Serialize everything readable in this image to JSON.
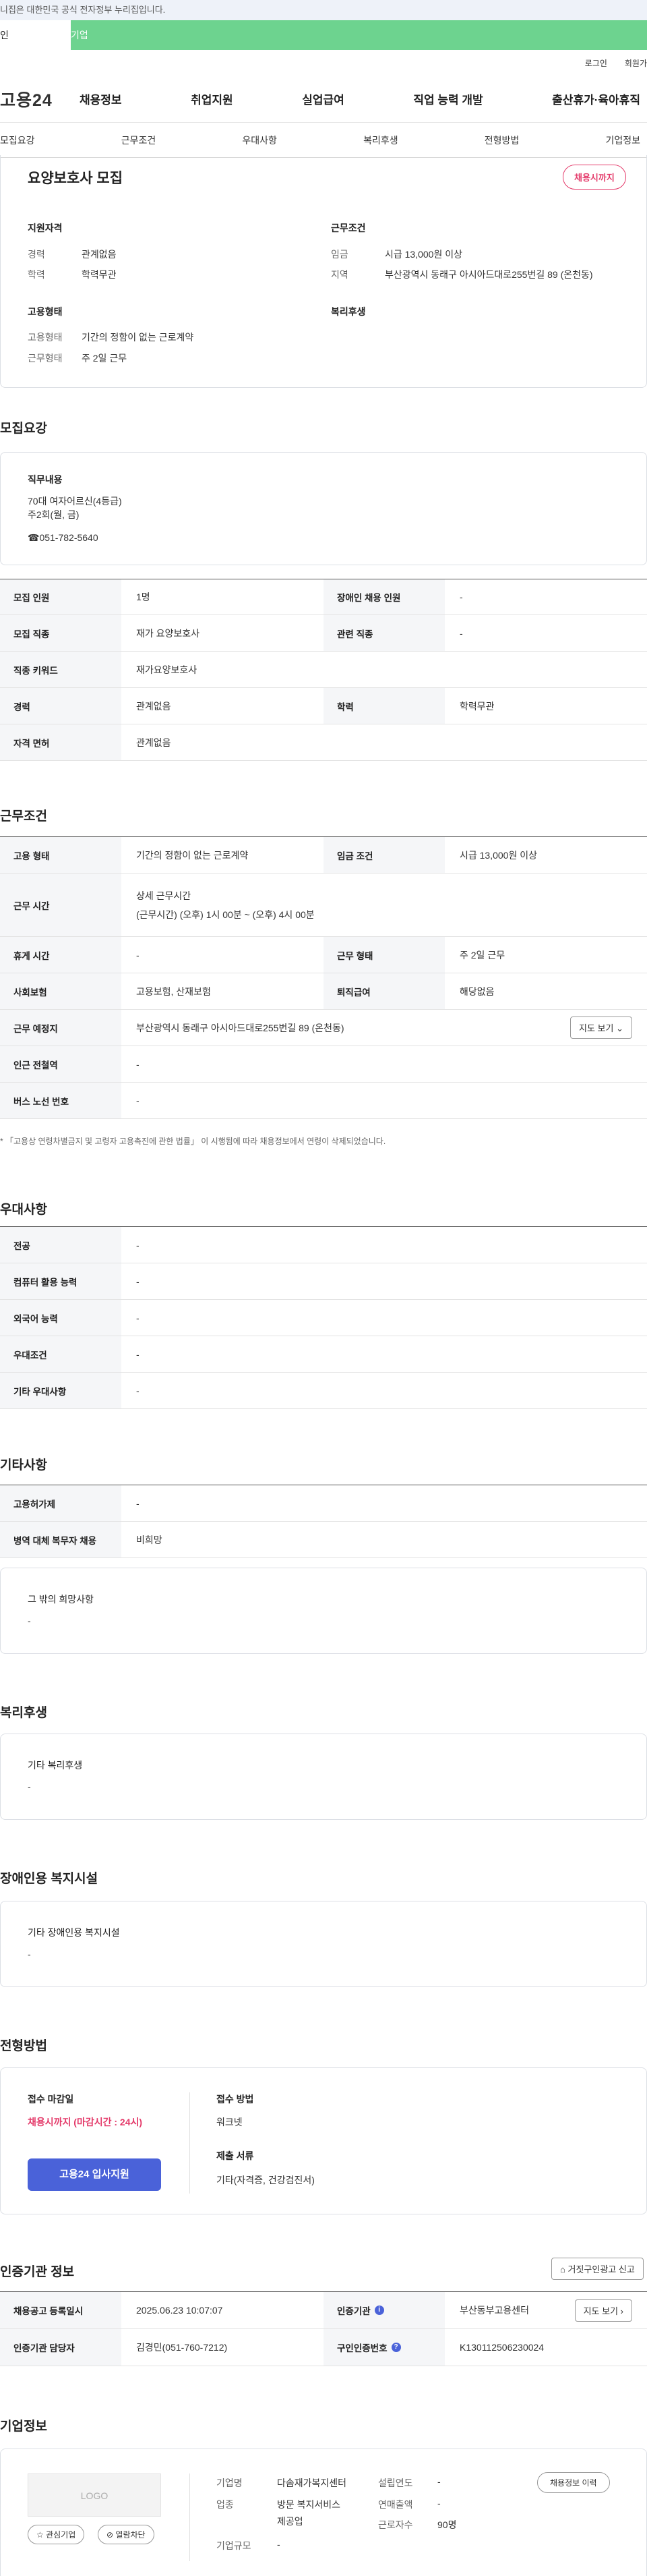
{
  "top": {
    "notice": "니집은 대한민국 공식 전자정부 누리집입니다.",
    "tab_a": "인",
    "tab_b": "기업",
    "login": "로그인",
    "signup": "회원가"
  },
  "gnb": {
    "logo": "고용24",
    "menu": [
      "채용정보",
      "취업지원",
      "실업급여",
      "직업 능력 개발",
      "출산휴가·육아휴직"
    ]
  },
  "subnav": [
    "모집요강",
    "근무조건",
    "우대사항",
    "복리후생",
    "전형방법",
    "기업정보"
  ],
  "summary": {
    "title": "요양보호사 모집",
    "status_badge": "채용시까지",
    "qual_title": "지원자격",
    "career_label": "경력",
    "career_value": "관계없음",
    "edu_label": "학력",
    "edu_value": "학력무관",
    "emp_title": "고용형태",
    "emp_type_label": "고용형태",
    "emp_type_value": "기간의 정함이 없는 근로계약",
    "work_type_label": "근무형태",
    "work_type_value": "주 2일 근무",
    "cond_title": "근무조건",
    "wage_label": "임금",
    "wage_value": "시급 13,000원 이상",
    "area_label": "지역",
    "area_value": "부산광역시 동래구 아시아드대로255번길 89 (온천동)",
    "welfare_title": "복리후생"
  },
  "recruit": {
    "section_title": "모집요강",
    "duty_title": "직무내용",
    "duty_line1": "70대 여자어르신(4등급)",
    "duty_line2": "주2회(월, 금)",
    "duty_line3": "☎051-782-5640",
    "rows": [
      [
        "모집 인원",
        "1명",
        "장애인 채용 인원",
        "-"
      ],
      [
        "모집 직종",
        "재가 요양보호사",
        "관련 직종",
        "-"
      ],
      [
        "직종 키워드",
        "재가요양보호사"
      ],
      [
        "경력",
        "관계없음",
        "학력",
        "학력무관"
      ],
      [
        "자격 면허",
        "관계없음"
      ]
    ]
  },
  "conditions": {
    "section_title": "근무조건",
    "emp_label": "고용 형태",
    "emp_value": "기간의 정함이 없는 근로계약",
    "wage_label": "임금 조건",
    "wage_value": "시급 13,000원 이상",
    "hours_label": "근무 시간",
    "hours_line1": "상세 근무시간",
    "hours_line2": "(근무시간) (오후) 1시 00분 ~ (오후) 4시 00분",
    "rest_label": "휴게 시간",
    "rest_value": "-",
    "form_label": "근무 형태",
    "form_value": "주 2일 근무",
    "ins_label": "사회보험",
    "ins_value": "고용보험, 산재보험",
    "sev_label": "퇴직급여",
    "sev_value": "해당없음",
    "place_label": "근무 예정지",
    "place_value": "부산광역시 동래구 아시아드대로255번길 89 (온천동)",
    "map_btn": "지도 보기",
    "subway_label": "인근 전철역",
    "subway_value": "-",
    "bus_label": "버스 노선 번호",
    "bus_value": "-",
    "footnote": "* 「고용상 연령차별금지 및 고령자 고용촉진에 관한 법률」 이 시행됨에 따라 채용정보에서 연령이 삭제되었습니다."
  },
  "preference": {
    "section_title": "우대사항",
    "rows": [
      [
        "전공",
        "-"
      ],
      [
        "컴퓨터 활용 능력",
        "-"
      ],
      [
        "외국어 능력",
        "-"
      ],
      [
        "우대조건",
        "-"
      ],
      [
        "기타 우대사항",
        "-"
      ]
    ]
  },
  "etc": {
    "section_title": "기타사항",
    "rows": [
      [
        "고용허가제",
        "-"
      ],
      [
        "병역 대체 복무자 채용",
        "비희망"
      ]
    ],
    "box_title": "그 밖의 희망사항",
    "box_value": "-"
  },
  "welfare": {
    "section_title": "복리후생",
    "box_title": "기타 복리후생",
    "box_value": "-"
  },
  "disability": {
    "section_title": "장애인용 복지시설",
    "box_title": "기타 장애인용 복지시설",
    "box_value": "-"
  },
  "process": {
    "section_title": "전형방법",
    "deadline_title": "접수 마감일",
    "deadline_value": "채용시까지 (마감시간 : 24시)",
    "apply_btn": "고용24 입사지원",
    "method_title": "접수 방법",
    "method_value": "워크넷",
    "docs_title": "제출 서류",
    "docs_value": "기타(자격증, 건강검진서)"
  },
  "agency": {
    "section_title": "인증기관 정보",
    "report_btn": "거짓구인광고 신고",
    "reg_date_label": "채용공고 등록일시",
    "reg_date_value": "2025.06.23 10:07:07",
    "agency_label": "인증기관",
    "agency_value": "부산동부고용센터",
    "map_btn": "지도 보기",
    "manager_label": "인증기관 담당자",
    "manager_value": "김경민(051-760-7212)",
    "cert_label": "구인인증번호",
    "cert_value": "K130112506230024"
  },
  "company": {
    "section_title": "기업정보",
    "logo_text": "LOGO",
    "fav_btn": "관심기업",
    "block_btn": "열람차단",
    "history_btn": "채용정보 이력",
    "name_label": "기업명",
    "name_value": "다솜재가복지센터",
    "industry_label": "업종",
    "industry_value1": "방문 복지서비스",
    "industry_value2": "제공업",
    "size_label": "기업규모",
    "size_value": "-",
    "founded_label": "설립연도",
    "founded_value": "-",
    "sales_label": "연매출액",
    "sales_value": "-",
    "staff_label": "근로자수",
    "staff_value": "90명"
  }
}
